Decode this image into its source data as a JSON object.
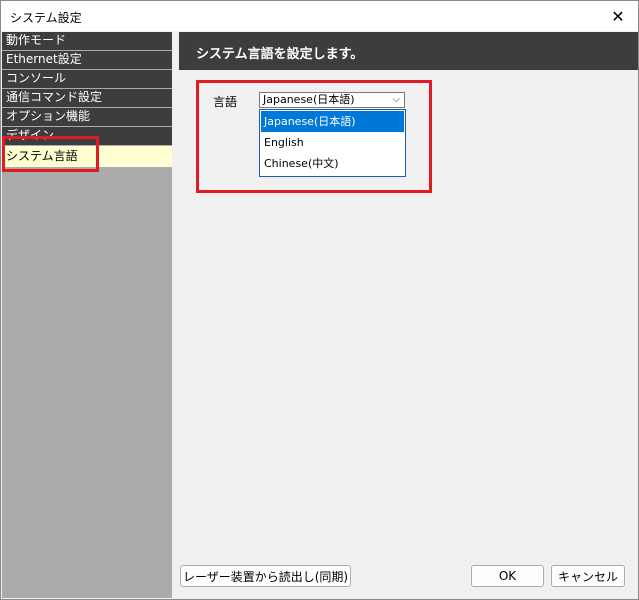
{
  "window": {
    "title": "システム設定"
  },
  "sidebar": {
    "items": [
      {
        "label": "動作モード"
      },
      {
        "label": "Ethernet設定"
      },
      {
        "label": "コンソール"
      },
      {
        "label": "通信コマンド設定"
      },
      {
        "label": "オプション機能"
      },
      {
        "label": "デザイン"
      },
      {
        "label": "システム言語"
      }
    ]
  },
  "main": {
    "header_title": "システム言語を設定します。",
    "language_label": "言語",
    "language_selected": "Japanese(日本語)",
    "language_options": [
      {
        "label": "Japanese(日本語)"
      },
      {
        "label": "English"
      },
      {
        "label": "Chinese(中文)"
      }
    ]
  },
  "buttons": {
    "sync": "レーザー装置から読出し(同期)",
    "ok": "OK",
    "cancel": "キャンセル"
  },
  "colors": {
    "highlight": "#e01b24",
    "selected_option": "#0078d7",
    "active_nav": "#ffffd2",
    "dark_header": "#3d3d3d"
  }
}
